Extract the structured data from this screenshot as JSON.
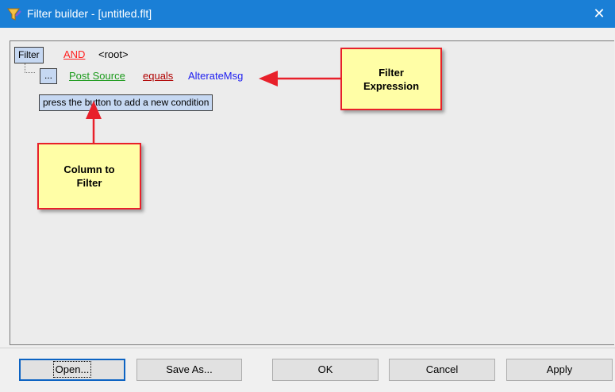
{
  "window": {
    "title": "Filter builder - [untitled.flt]",
    "close_glyph": "✕"
  },
  "icons": {
    "app": "funnel-icon",
    "close": "close-icon"
  },
  "filter": {
    "root_button": "Filter",
    "group_operator": "AND",
    "root_label": "<root>",
    "condition": {
      "menu_button": "...",
      "column": "Post Source",
      "operator": "equals",
      "value": "AlterateMsg"
    },
    "hint": "press the button to add a new condition"
  },
  "annotations": {
    "filter_expression": [
      "Filter",
      "Expression"
    ],
    "column_to_filter": [
      "Column to",
      "Filter"
    ]
  },
  "buttons": {
    "open": "Open...",
    "save_as": "Save As...",
    "ok": "OK",
    "cancel": "Cancel",
    "apply": "Apply"
  },
  "colors": {
    "titlebar": "#1a7fd6",
    "group_operator": "#ff2020",
    "column": "#1b9a1b",
    "operator": "#b00000",
    "value": "#1e1ef0",
    "callout_fill": "#fffea6",
    "callout_border": "#e8202a"
  }
}
